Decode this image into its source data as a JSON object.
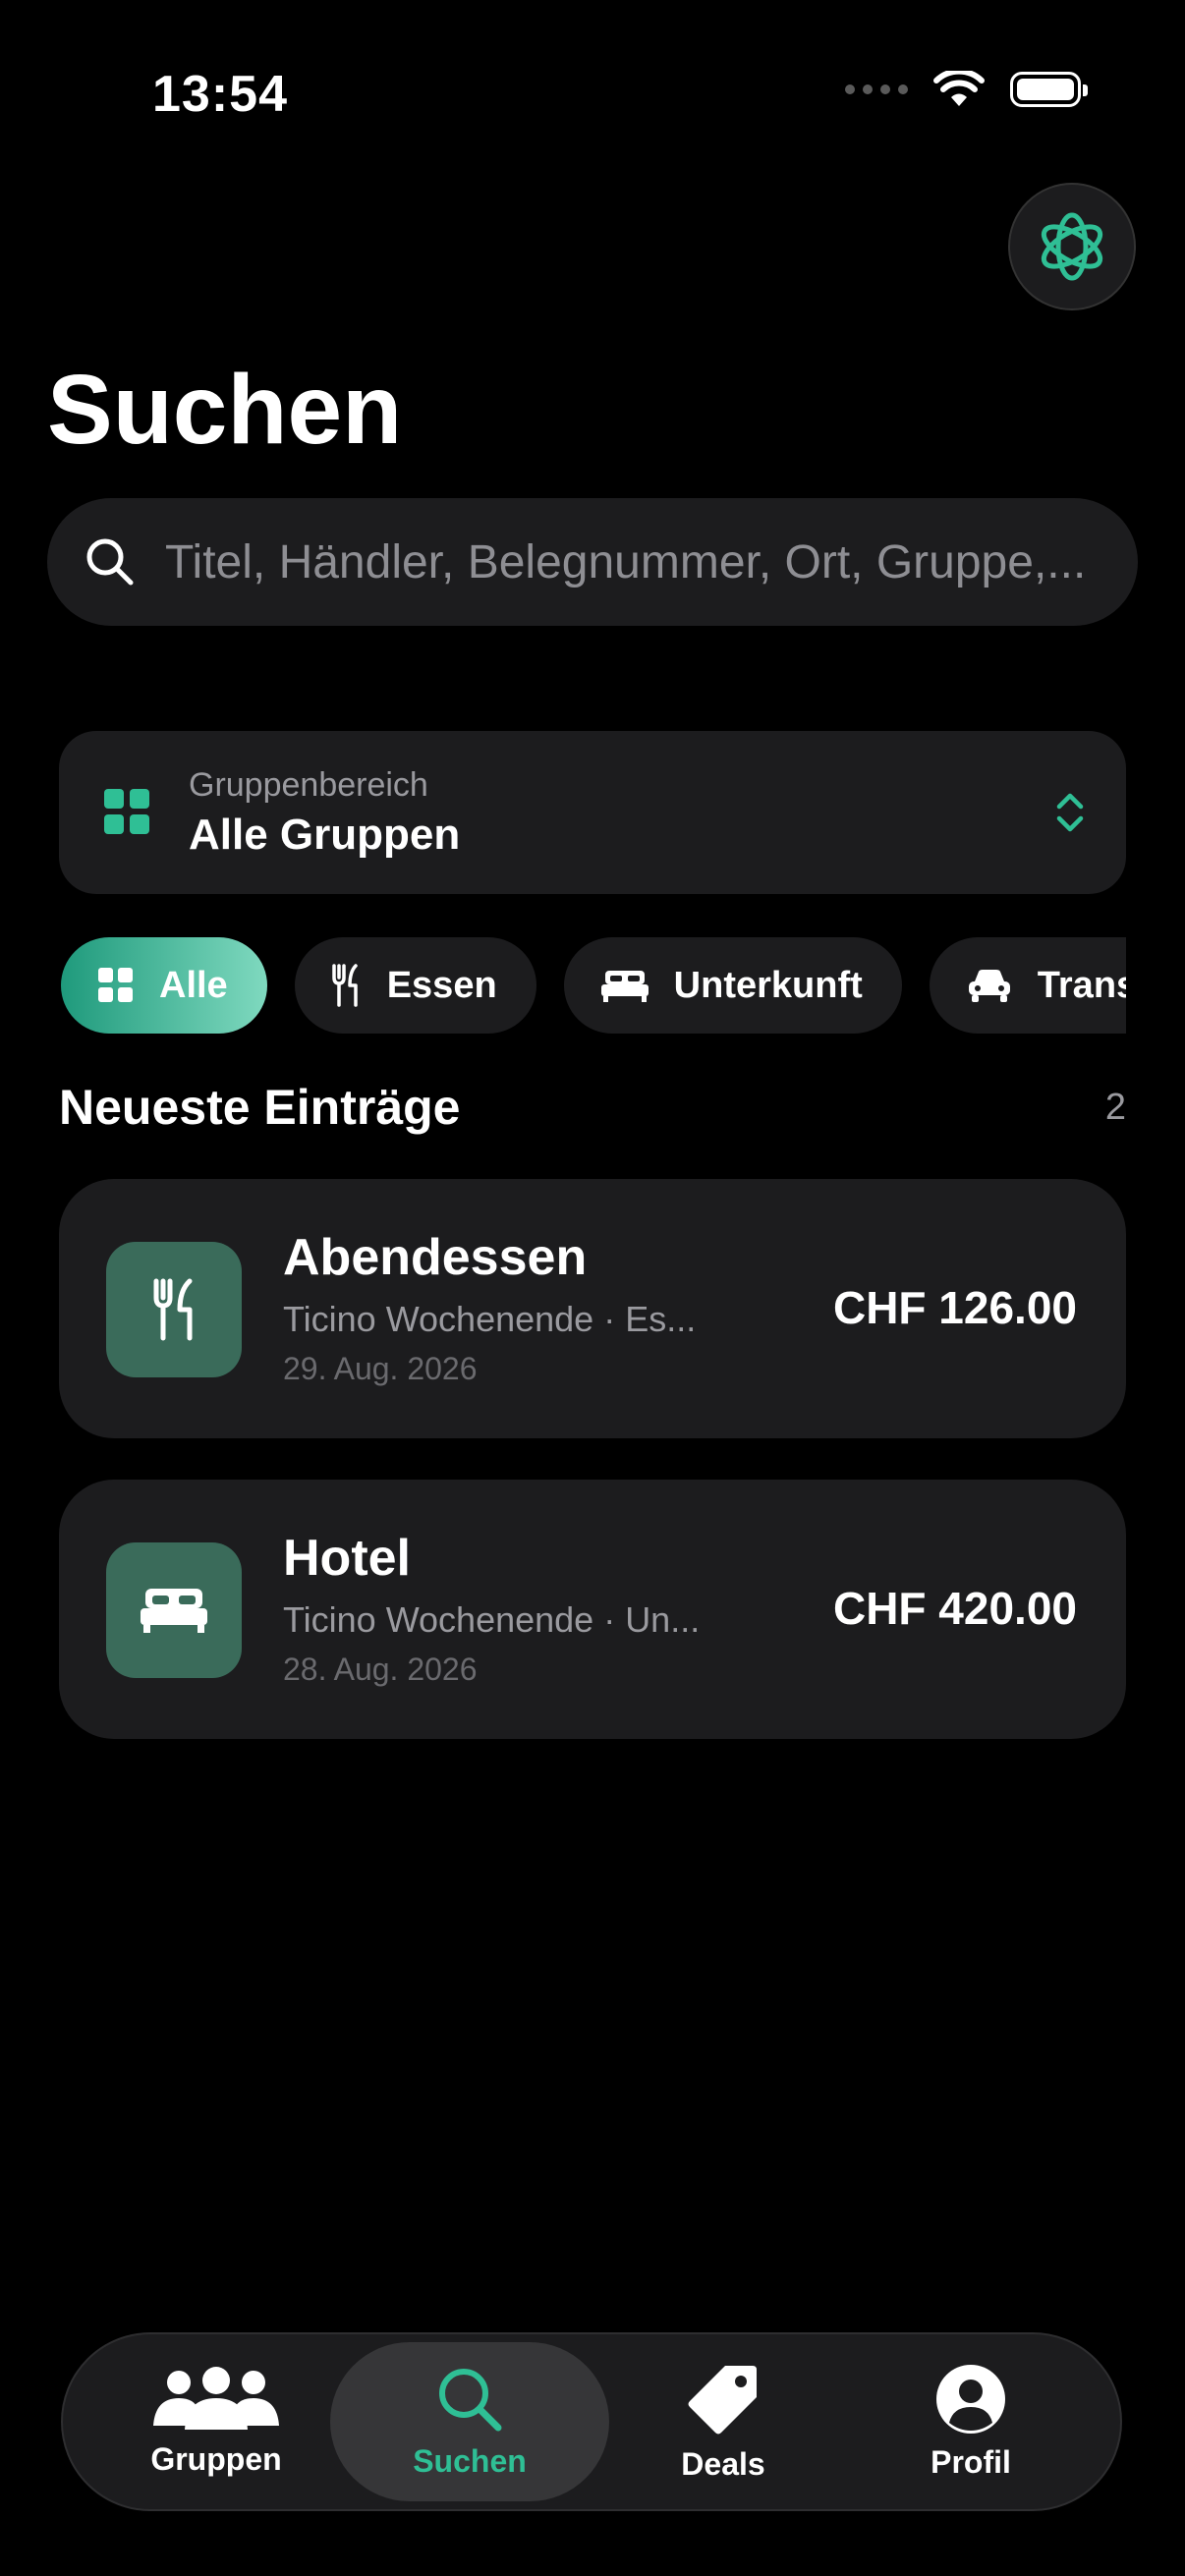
{
  "status_bar": {
    "time": "13:54"
  },
  "header": {
    "title": "Suchen",
    "ai_button_icon": "sparkle-icon"
  },
  "search": {
    "placeholder": "Titel, Händler, Belegnummer, Ort, Gruppe,..."
  },
  "group_selector": {
    "caption": "Gruppenbereich",
    "value": "Alle Gruppen"
  },
  "filters": [
    {
      "label": "Alle",
      "icon": "grid-icon",
      "active": true
    },
    {
      "label": "Essen",
      "icon": "fork-knife-icon",
      "active": false
    },
    {
      "label": "Unterkunft",
      "icon": "bed-icon",
      "active": false
    },
    {
      "label": "Transport",
      "icon": "car-icon",
      "active": false
    }
  ],
  "section": {
    "title": "Neueste Einträge",
    "count": "2"
  },
  "entries": [
    {
      "title": "Abendessen",
      "subtitle": "Ticino Wochenende · Es...",
      "date": "29. Aug. 2026",
      "amount": "CHF 126.00",
      "icon": "fork-knife-icon"
    },
    {
      "title": "Hotel",
      "subtitle": "Ticino Wochenende · Un...",
      "date": "28. Aug. 2026",
      "amount": "CHF 420.00",
      "icon": "bed-icon"
    }
  ],
  "tabbar": [
    {
      "label": "Gruppen",
      "icon": "people-icon",
      "active": false
    },
    {
      "label": "Suchen",
      "icon": "search-icon",
      "active": true
    },
    {
      "label": "Deals",
      "icon": "tag-icon",
      "active": false
    },
    {
      "label": "Profil",
      "icon": "person-circle-icon",
      "active": false
    }
  ],
  "colors": {
    "accent": "#2fbf95",
    "card": "#1c1c1e",
    "icon_bg": "#3a6b5a"
  }
}
